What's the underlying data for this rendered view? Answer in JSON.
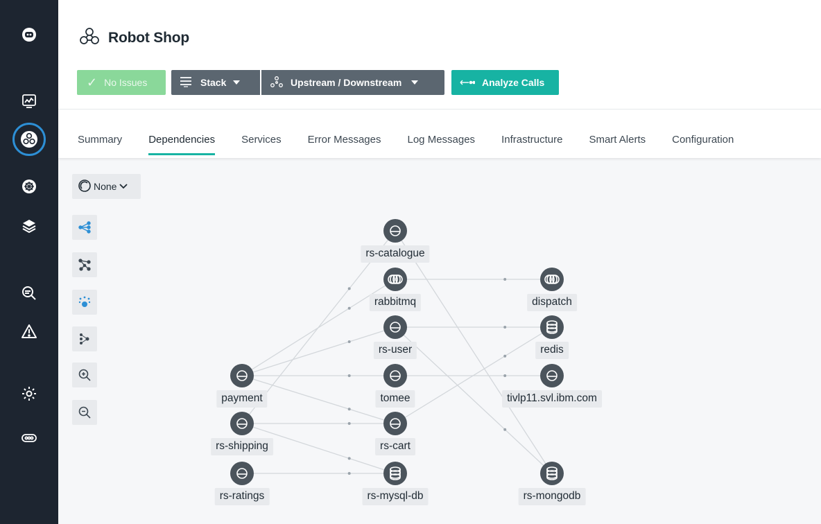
{
  "app": {
    "title": "Robot Shop",
    "accent": "#17b3a3",
    "sidebar_bg": "#1d2530"
  },
  "sidebar": {
    "items": [
      {
        "icon": "robot-icon"
      },
      {
        "icon": "dashboard-icon"
      },
      {
        "icon": "application-perspective-icon",
        "active": true
      },
      {
        "icon": "kubernetes-icon"
      },
      {
        "icon": "platform-layers-icon"
      },
      {
        "icon": "analyze-search-icon"
      },
      {
        "icon": "warning-icon"
      },
      {
        "icon": "settings-icon"
      },
      {
        "icon": "more-icon"
      }
    ]
  },
  "toolbar": {
    "status_label": "No Issues",
    "stack_label": "Stack",
    "updown_label": "Upstream / Downstream",
    "analyze_label": "Analyze Calls"
  },
  "tabs": [
    {
      "label": "Summary",
      "active": false
    },
    {
      "label": "Dependencies",
      "active": true
    },
    {
      "label": "Services",
      "active": false
    },
    {
      "label": "Error Messages",
      "active": false
    },
    {
      "label": "Log Messages",
      "active": false
    },
    {
      "label": "Infrastructure",
      "active": false
    },
    {
      "label": "Smart Alerts",
      "active": false
    },
    {
      "label": "Configuration",
      "active": false
    }
  ],
  "panel": {
    "group_by_value": "None",
    "tools": [
      "layout-tree-icon",
      "layout-force-icon",
      "layout-cluster-icon",
      "layout-hierarchy-icon",
      "zoom-in-icon",
      "zoom-out-icon"
    ]
  },
  "graph": {
    "nodes": [
      {
        "id": "rs-catalogue",
        "label": "rs-catalogue",
        "kind": "service"
      },
      {
        "id": "rabbitmq",
        "label": "rabbitmq",
        "kind": "queue"
      },
      {
        "id": "dispatch",
        "label": "dispatch",
        "kind": "queue"
      },
      {
        "id": "rs-user",
        "label": "rs-user",
        "kind": "service"
      },
      {
        "id": "redis",
        "label": "redis",
        "kind": "database"
      },
      {
        "id": "payment",
        "label": "payment",
        "kind": "service"
      },
      {
        "id": "tomee",
        "label": "tomee",
        "kind": "service"
      },
      {
        "id": "tivlp11",
        "label": "tivlp11.svl.ibm.com",
        "kind": "service"
      },
      {
        "id": "rs-shipping",
        "label": "rs-shipping",
        "kind": "service"
      },
      {
        "id": "rs-cart",
        "label": "rs-cart",
        "kind": "service"
      },
      {
        "id": "rs-ratings",
        "label": "rs-ratings",
        "kind": "service"
      },
      {
        "id": "rs-mysql-db",
        "label": "rs-mysql-db",
        "kind": "database"
      },
      {
        "id": "rs-mongodb",
        "label": "rs-mongodb",
        "kind": "database"
      }
    ],
    "edges": [
      [
        "rabbitmq",
        "dispatch"
      ],
      [
        "rs-catalogue",
        "rs-mongodb"
      ],
      [
        "rs-user",
        "redis"
      ],
      [
        "rs-user",
        "rs-mongodb"
      ],
      [
        "payment",
        "rabbitmq"
      ],
      [
        "payment",
        "rs-user"
      ],
      [
        "payment",
        "tomee"
      ],
      [
        "payment",
        "rs-cart"
      ],
      [
        "tomee",
        "tivlp11"
      ],
      [
        "rs-shipping",
        "rs-catalogue"
      ],
      [
        "rs-shipping",
        "rs-cart"
      ],
      [
        "rs-shipping",
        "rs-mysql-db"
      ],
      [
        "rs-cart",
        "redis"
      ],
      [
        "rs-ratings",
        "rs-mysql-db"
      ]
    ]
  }
}
